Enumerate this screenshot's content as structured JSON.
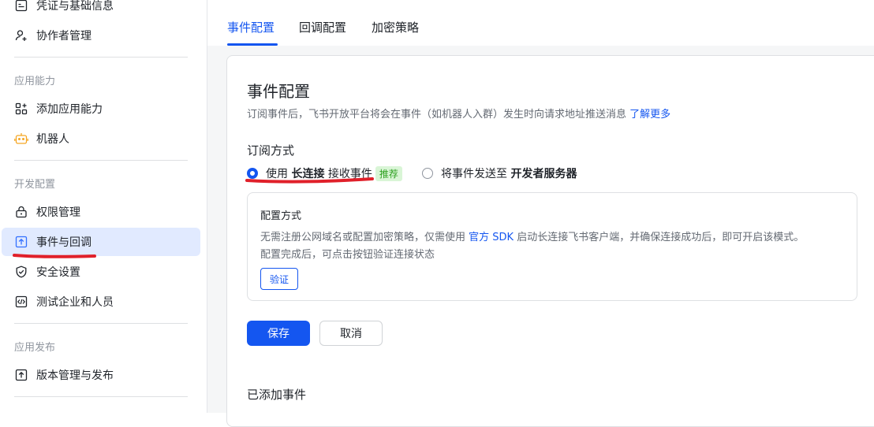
{
  "sidebar": {
    "items": [
      {
        "label": "凭证与基础信息",
        "icon": "id-card-icon"
      },
      {
        "label": "协作者管理",
        "icon": "add-user-icon"
      },
      {
        "label": "添加应用能力",
        "icon": "apps-add-icon"
      },
      {
        "label": "机器人",
        "icon": "robot-icon"
      },
      {
        "label": "权限管理",
        "icon": "lock-icon"
      },
      {
        "label": "事件与回调",
        "icon": "upload-box-icon"
      },
      {
        "label": "安全设置",
        "icon": "shield-check-icon"
      },
      {
        "label": "测试企业和人员",
        "icon": "code-box-icon"
      },
      {
        "label": "版本管理与发布",
        "icon": "upload-box-icon"
      }
    ],
    "sections": {
      "app_capability": "应用能力",
      "dev_config": "开发配置",
      "app_release": "应用发布"
    },
    "active_item": "事件与回调"
  },
  "tabs": [
    {
      "label": "事件配置",
      "active": true
    },
    {
      "label": "回调配置",
      "active": false
    },
    {
      "label": "加密策略",
      "active": false
    }
  ],
  "card": {
    "title": "事件配置",
    "description": "订阅事件后，飞书开放平台将会在事件（如机器人入群）发生时向请求地址推送消息",
    "learn_more": "了解更多",
    "subscription_title": "订阅方式",
    "option_long": {
      "prefix": "使用",
      "bold": "长连接",
      "suffix": "接收事件",
      "badge": "推荐",
      "selected": true
    },
    "option_server": {
      "prefix": "将事件发送至",
      "bold": "开发者服务器",
      "selected": false
    },
    "config": {
      "title": "配置方式",
      "line1_prefix": "无需注册公网域名或配置加密策略，仅需使用",
      "line1_link": "官方 SDK",
      "line1_suffix": "启动长连接飞书客户端，并确保连接成功后，即可开启该模式。",
      "line2": "配置完成后，可点击按钮验证连接状态",
      "verify_label": "验证"
    },
    "save_label": "保存",
    "cancel_label": "取消",
    "added_events_title": "已添加事件"
  },
  "colors": {
    "accent": "#1456f0",
    "active_bg": "#e1eaff",
    "annotation_red": "#e0202a",
    "badge_bg": "#d9f5d6",
    "badge_text": "#2ea121"
  }
}
